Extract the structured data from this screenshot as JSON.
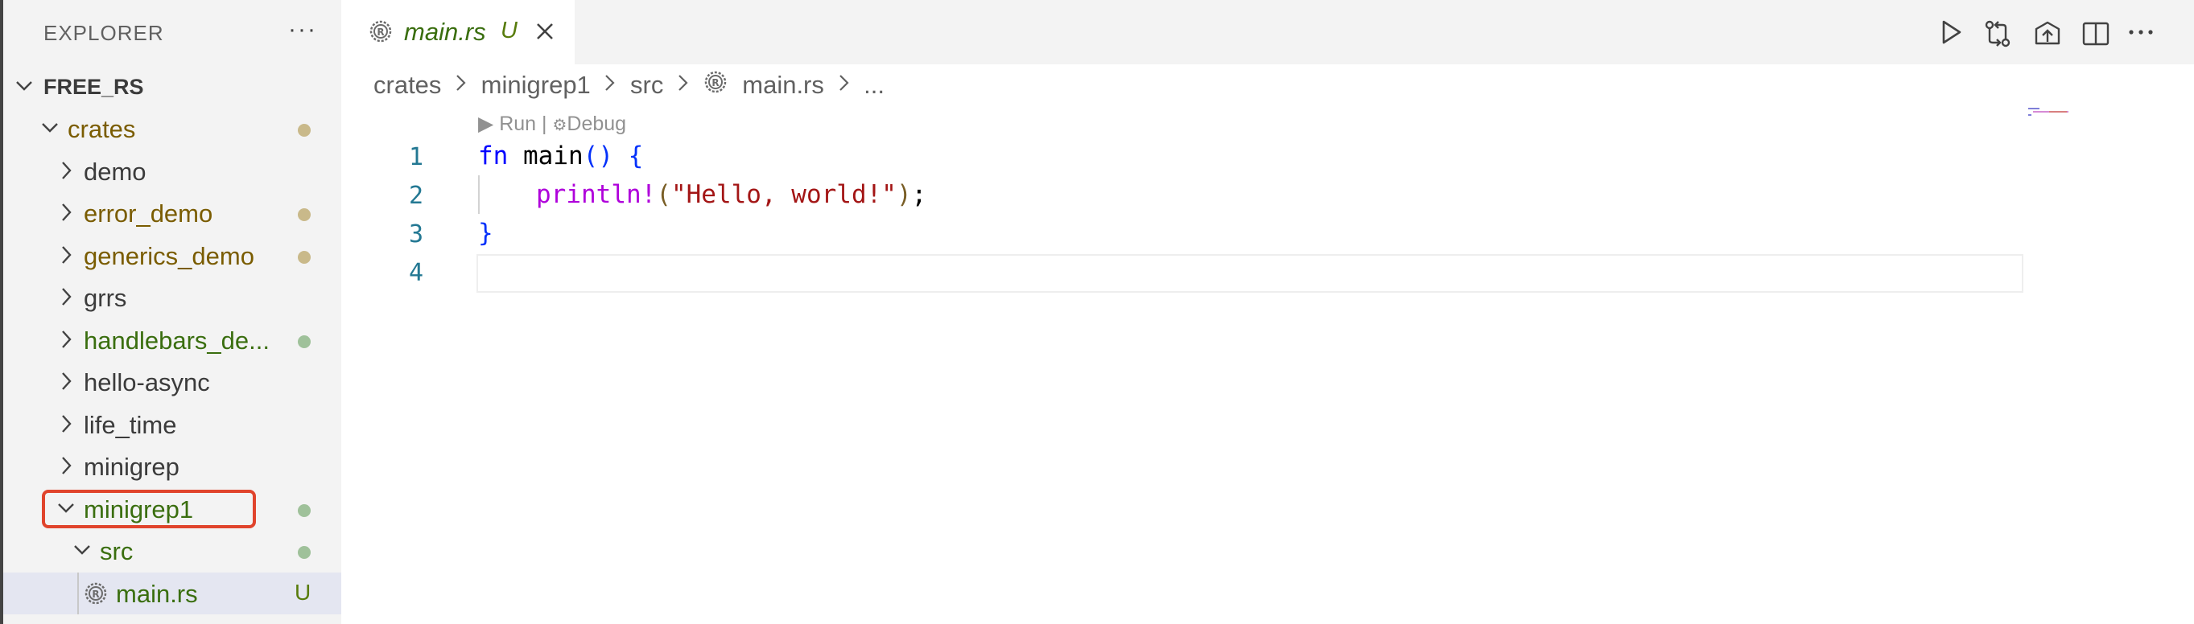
{
  "sidebar": {
    "title": "EXPLORER",
    "more": "···",
    "root": "FREE_RS",
    "items": [
      {
        "label": "crates",
        "expanded": true,
        "color": "#7a5c00",
        "dot": "#c9b98a"
      },
      {
        "label": "demo",
        "expanded": false,
        "color": "#3b3b3b",
        "dot": null
      },
      {
        "label": "error_demo",
        "expanded": false,
        "color": "#7a5c00",
        "dot": "#c9b98a"
      },
      {
        "label": "generics_demo",
        "expanded": false,
        "color": "#7a5c00",
        "dot": "#c9b98a"
      },
      {
        "label": "grrs",
        "expanded": false,
        "color": "#3b3b3b",
        "dot": null
      },
      {
        "label": "handlebars_de...",
        "expanded": false,
        "color": "#3a6e0f",
        "dot": "#9fc19a"
      },
      {
        "label": "hello-async",
        "expanded": false,
        "color": "#3b3b3b",
        "dot": null
      },
      {
        "label": "life_time",
        "expanded": false,
        "color": "#3b3b3b",
        "dot": null
      },
      {
        "label": "minigrep",
        "expanded": false,
        "color": "#3b3b3b",
        "dot": null
      },
      {
        "label": "minigrep1",
        "expanded": true,
        "color": "#3a6e0f",
        "dot": "#9fc19a"
      },
      {
        "label": "src",
        "expanded": true,
        "color": "#3a6e0f",
        "dot": "#9fc19a"
      },
      {
        "label": "main.rs",
        "file": true,
        "color": "#3a6e0f",
        "badge": "U"
      }
    ]
  },
  "tab": {
    "name": "main.rs",
    "badge": "U"
  },
  "breadcrumbs": [
    "crates",
    "minigrep1",
    "src",
    "main.rs",
    "..."
  ],
  "codelens": {
    "run": "Run",
    "sep": "|",
    "debug": "Debug"
  },
  "editor": {
    "line_numbers": [
      "1",
      "2",
      "3",
      "4"
    ],
    "line1": {
      "kw": "fn",
      "name": "main",
      "parens": "()",
      "brace": "{"
    },
    "line2": {
      "macro": "println!",
      "open": "(",
      "str": "\"Hello, world!\"",
      "close": ")",
      "semi": ";"
    },
    "line3": {
      "brace": "}"
    }
  },
  "colors": {
    "accent": "#0000ff",
    "highlight": "#e0442c",
    "git_untracked": "#587c0c"
  }
}
